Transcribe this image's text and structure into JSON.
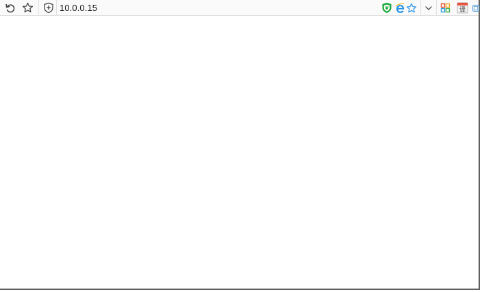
{
  "browser": {
    "address_bar": {
      "url": "10.0.0.15"
    },
    "toolbar_left": [
      {
        "icon": "reload-icon"
      },
      {
        "icon": "bookmark-star-icon"
      },
      {
        "icon": "security-shield-icon"
      }
    ],
    "toolbar_right": [
      {
        "icon": "green-shield-extension-icon",
        "color": "#1aa83a"
      },
      {
        "icon": "ie-compat-icon",
        "color": "#1e8fe6"
      },
      {
        "icon": "favorite-star-icon",
        "color": "#3b9be8"
      },
      {
        "icon": "chevron-down-icon"
      },
      {
        "icon": "apps-grid-icon"
      },
      {
        "icon": "translate-icon",
        "label": "译"
      },
      {
        "icon": "screenshot-icon"
      }
    ]
  },
  "page": {
    "background": "#ffffff"
  }
}
